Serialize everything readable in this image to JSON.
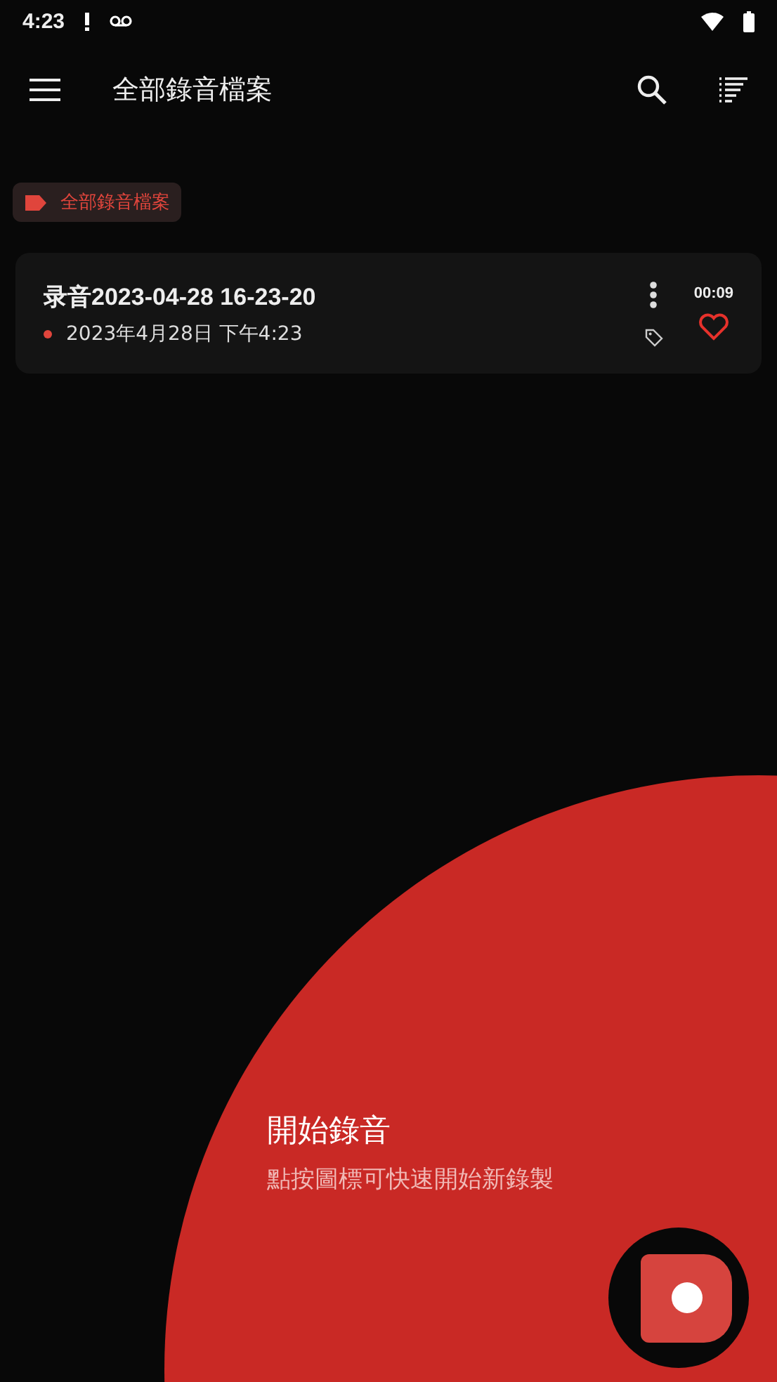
{
  "status_bar": {
    "time": "4:23"
  },
  "app_bar": {
    "title": "全部錄音檔案"
  },
  "filter_chip": {
    "label": "全部錄音檔案"
  },
  "recordings": [
    {
      "title": "录音2023-04-28 16-23-20",
      "date": "2023年4月28日 下午4:23",
      "duration": "00:09",
      "color": "#e0453c"
    }
  ],
  "tutorial": {
    "title": "開始錄音",
    "subtitle": "點按圖標可快速開始新錄製"
  }
}
